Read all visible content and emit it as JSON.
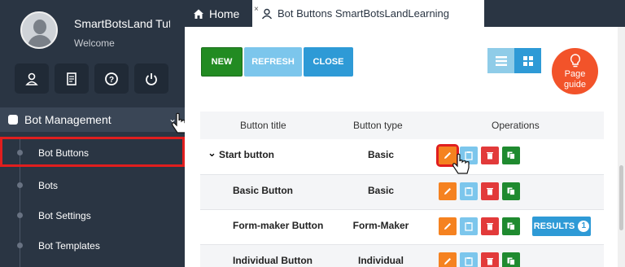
{
  "sidebar": {
    "profile": {
      "name": "SmartBotsLand Tutorial",
      "welcome": "Welcome"
    },
    "quick_buttons": [
      {
        "icon": "user-icon"
      },
      {
        "icon": "document-icon"
      },
      {
        "icon": "help-icon"
      },
      {
        "icon": "power-icon"
      }
    ],
    "section": {
      "label": "Bot Management",
      "icon": "bot-icon"
    },
    "items": [
      {
        "label": "Bot Buttons",
        "active": true
      },
      {
        "label": "Bots"
      },
      {
        "label": "Bot Settings"
      },
      {
        "label": "Bot Templates"
      }
    ]
  },
  "tabs": {
    "home": "Home",
    "active": "Bot Buttons SmartBotsLandLearning",
    "close": "×"
  },
  "toolbar": {
    "new": "NEW",
    "refresh": "REFRESH",
    "close": "CLOSE",
    "guide": "Page guide"
  },
  "table": {
    "headers": {
      "title": "Button title",
      "type": "Button type",
      "operations": "Operations"
    },
    "rows": [
      {
        "title": "Start button",
        "type": "Basic",
        "expander": "⌄"
      },
      {
        "title": "Basic Button",
        "type": "Basic"
      },
      {
        "title": "Form-maker Button",
        "type": "Form-Maker",
        "results": {
          "label": "RESULTS",
          "count": "1"
        }
      },
      {
        "title": "Individual Button",
        "type": "Individual"
      }
    ]
  },
  "colors": {
    "sidebar": "#2a3543",
    "new": "#228b22",
    "refresh": "#7cc6ec",
    "close": "#2e9ad6",
    "edit": "#f58220",
    "delete": "#e23a3a",
    "duplicate": "#1f8a2f",
    "guide": "#f2532a",
    "highlight": "#e01e1e"
  }
}
